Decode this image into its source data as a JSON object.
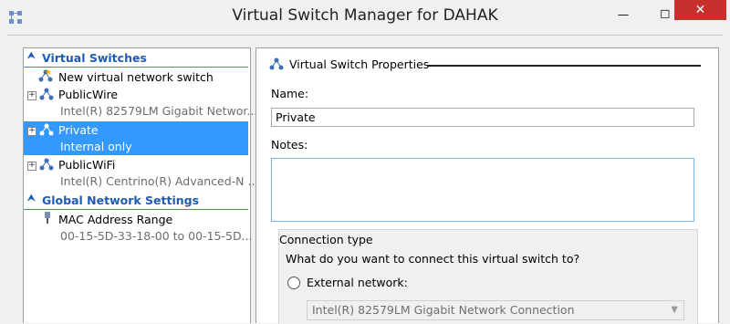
{
  "window": {
    "title": "Virtual Switch Manager for DAHAK",
    "close_glyph": "✕",
    "minimize_glyph": "—",
    "maximize_glyph": "☐"
  },
  "left_pane": {
    "virtual_switches_header": "Virtual Switches",
    "global_settings_header": "Global Network Settings",
    "collapse_glyph": "⮝",
    "expander_glyph": "+",
    "items": [
      {
        "name": "New virtual network switch",
        "icon": "new-switch-icon"
      },
      {
        "name": "PublicWire",
        "sub": "Intel(R) 82579LM Gigabit Networ...",
        "icon": "network-switch-icon"
      },
      {
        "name": "Private",
        "sub": "Internal only",
        "icon": "network-switch-icon",
        "selected": true
      },
      {
        "name": "PublicWiFi",
        "sub": "Intel(R) Centrino(R) Advanced-N ...",
        "icon": "network-switch-icon"
      }
    ],
    "mac": {
      "name": "MAC Address Range",
      "sub": "00-15-5D-33-18-00 to 00-15-5D...",
      "icon": "network-adapter-icon"
    }
  },
  "right_pane": {
    "section_title": "Virtual Switch Properties",
    "name_label": "Name:",
    "name_value": "Private",
    "notes_label": "Notes:",
    "notes_value": "",
    "connection_type_label": "Connection type",
    "connection_question": "What do you want to connect this virtual switch to?",
    "external_network_label": "External network:",
    "external_adapter": "Intel(R) 82579LM Gigabit Network Connection"
  },
  "colors": {
    "accent": "#1e5bb5",
    "selection": "#3399ff",
    "close": "#c7302c"
  }
}
